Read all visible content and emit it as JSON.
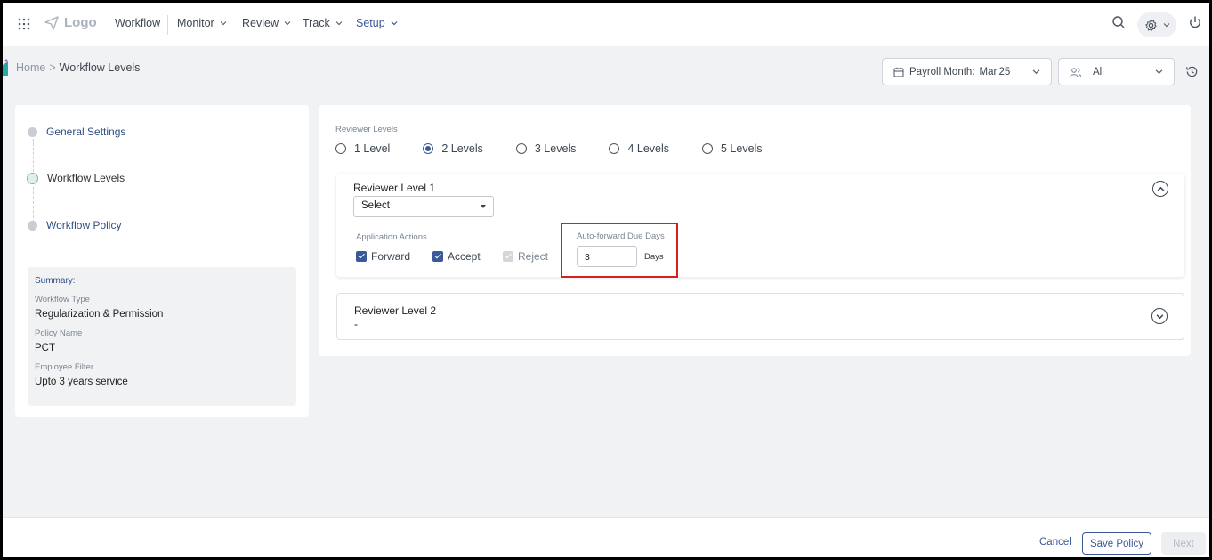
{
  "nav": {
    "logo_text": "Logo",
    "items": [
      {
        "label": "Workflow"
      },
      {
        "label": "Monitor"
      },
      {
        "label": "Review"
      },
      {
        "label": "Track"
      },
      {
        "label": "Setup"
      }
    ]
  },
  "breadcrumb": {
    "home": "Home",
    "separator": ">",
    "current": "Workflow Levels"
  },
  "filters": {
    "payroll_label": "Payroll Month:",
    "payroll_value": "Mar'25",
    "group_value": "All"
  },
  "steps": [
    {
      "label": "General Settings",
      "state": "done"
    },
    {
      "label": "Workflow Levels",
      "state": "current"
    },
    {
      "label": "Workflow Policy",
      "state": "pending"
    }
  ],
  "summary": {
    "title": "Summary:",
    "workflow_type_label": "Workflow Type",
    "workflow_type_value": "Regularization & Permission",
    "policy_name_label": "Policy Name",
    "policy_name_value": "PCT",
    "employee_filter_label": "Employee Filter",
    "employee_filter_value": "Upto 3 years service"
  },
  "reviewer_levels": {
    "label": "Reviewer Levels",
    "options": [
      "1 Level",
      "2 Levels",
      "3 Levels",
      "4 Levels",
      "5 Levels"
    ],
    "selected": "2 Levels"
  },
  "level1": {
    "title": "Reviewer Level 1",
    "select_value": "Select",
    "actions_label": "Application Actions",
    "actions": [
      {
        "label": "Forward",
        "checked": true
      },
      {
        "label": "Accept",
        "checked": true
      },
      {
        "label": "Reject",
        "checked": true,
        "disabled": true
      }
    ],
    "auto_forward_label": "Auto-forward Due Days",
    "auto_forward_value": "3",
    "days_label": "Days"
  },
  "level2": {
    "title": "Reviewer Level 2",
    "value": "-"
  },
  "footer": {
    "cancel_label": "Cancel",
    "save_label": "Save Policy",
    "next_label": "Next"
  },
  "colors": {
    "accent": "#3b5998",
    "highlight": "#d61f1f",
    "background": "#f1f2f4"
  }
}
